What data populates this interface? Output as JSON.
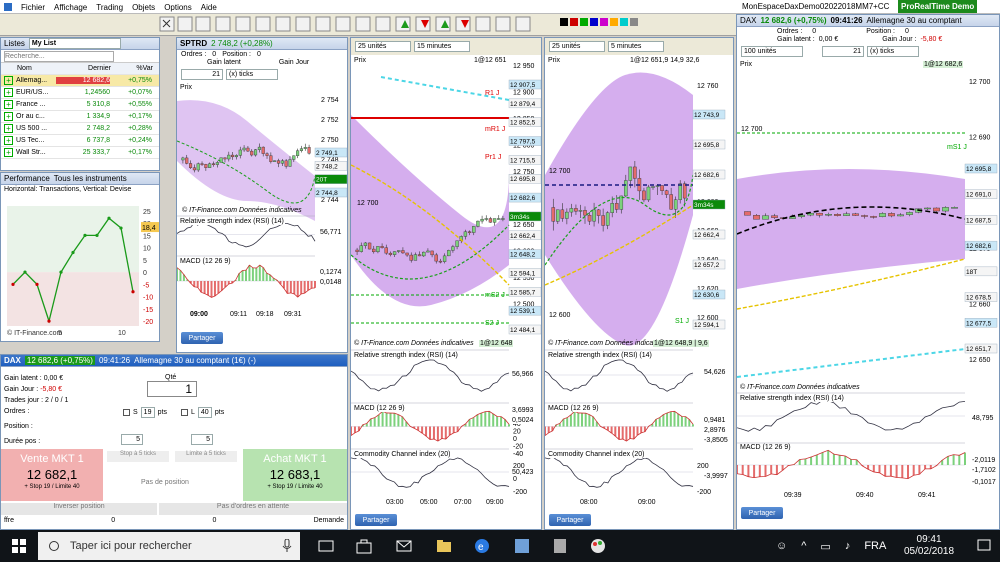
{
  "menu": {
    "items": [
      "Fichier",
      "Affichage",
      "Trading",
      "Objets",
      "Options",
      "Aide"
    ]
  },
  "window": {
    "title": "MonEspaceDaxDemo02022018MM7+CC",
    "badge": "ProRealTime Demo"
  },
  "watchlist": {
    "tabs": [
      "Listes",
      "My List"
    ],
    "search_placeholder": "Recherche...",
    "columns": [
      "Nom",
      "Dernier",
      "%Var"
    ],
    "rows": [
      {
        "name": "Allemag...",
        "last": "12 682,6",
        "chg": "+0,75%",
        "selected": true
      },
      {
        "name": "EUR/US...",
        "last": "1,24560",
        "chg": "+0,07%"
      },
      {
        "name": "France ...",
        "last": "5 310,8",
        "chg": "+0,55%"
      },
      {
        "name": "Or au c...",
        "last": "1 334,9",
        "chg": "+0,17%"
      },
      {
        "name": "US 500 ...",
        "last": "2 748,2",
        "chg": "+0,28%"
      },
      {
        "name": "US Tec...",
        "last": "6 737,8",
        "chg": "+0,24%"
      },
      {
        "name": "Wall Str...",
        "last": "25 333,7",
        "chg": "+0,17%"
      }
    ]
  },
  "performance": {
    "tabs": [
      "Performance",
      "Tous les instruments"
    ],
    "header": "Horizontal: Transactions, Vertical: Devise",
    "y_ticks": [
      "25",
      "20",
      "15",
      "10",
      "5",
      "0",
      "-5",
      "-10",
      "-15",
      "-20"
    ],
    "x_ticks": [
      "5",
      "10"
    ],
    "value_label": "18,4",
    "footer": "© IT-Finance.com",
    "chart_data": {
      "type": "line",
      "x": [
        1,
        2,
        3,
        4,
        5,
        6,
        7,
        8,
        9,
        10,
        11
      ],
      "values": [
        -5,
        0,
        -5,
        -20,
        0,
        8,
        15,
        15,
        22,
        18,
        -8
      ]
    }
  },
  "spx": {
    "title": "SPTRD",
    "price": "2 748,2 (+0,28%)",
    "orders_label": "Ordres :",
    "orders_value": "0",
    "position_label": "Position :",
    "position_value": "0",
    "gain_latent": "Gain latent",
    "gain_jour": "Gain Jour",
    "unit_select": "21",
    "type_select": "(x) ticks",
    "prix_label": "Prix",
    "y_ticks": [
      "2 754",
      "2 752",
      "2 750",
      "2 748",
      "2 746",
      "2 744"
    ],
    "price_tags": [
      "2 749,1",
      "2 748,2",
      "20T",
      "2 744,8"
    ],
    "rsi_title": "Relative strength index (RSI) (14)",
    "rsi_value": "56,771",
    "macd_title": "MACD (12 26 9)",
    "macd_values": [
      "0,1274",
      "0,0148"
    ],
    "x_ticks": [
      "09:00",
      "09:11",
      "09:18",
      "09:31"
    ],
    "credit": "© IT-Finance.com Données indicatives",
    "share": "Partager"
  },
  "dax_order": {
    "title": "DAX",
    "price": "12 682,6 (+0,75%)",
    "time": "09:41:26",
    "desc": "Allemagne 30 au comptant (1€) (-)",
    "gain_latent_label": "Gain latent :",
    "gain_latent": "0,00 €",
    "gain_jour_label": "Gain Jour :",
    "gain_jour": "-5,80 €",
    "trades_label": "Trades jour :",
    "trades": "2 / 0 / 1",
    "orders_label": "Ordres :",
    "position_label": "Position :",
    "duree_label": "Durée pos :",
    "qty_label": "Qté",
    "qty": "1",
    "stop_label": "S",
    "stop_value": "19",
    "stop_unit": "pts",
    "limit_label": "L",
    "limit_value": "40",
    "limit_unit": "pts",
    "spin1": "5",
    "spin2": "5",
    "sell_label": "Vente MKT 1",
    "sell_price": "12 682,1",
    "sell_sub": "+ Stop 19 / Limite 40",
    "buy_label": "Achat MKT 1",
    "buy_price": "12 683,1",
    "buy_sub": "+ Stop 19 / Limite 40",
    "stop5": "Stop à 5 ticks",
    "limit5": "Limite à 5 ticks",
    "no_position": "Pas de position",
    "reverse": "Inverser position",
    "no_pending": "Pas d'ordres en attente",
    "footer_left": "ffre",
    "footer_right": "Demande",
    "footer_values": [
      "0",
      "0"
    ]
  },
  "chart1": {
    "units": "25 unités",
    "interval": "15 minutes",
    "prix_label": "Prix",
    "header_price": "1@12 651",
    "y_ticks": [
      "12 950",
      "12 900",
      "12 850",
      "12 800",
      "12 750",
      "12 700",
      "12 650",
      "12 600",
      "12 550",
      "12 500",
      "12 450"
    ],
    "price_tags": [
      "12 907,5",
      "12 879,4",
      "12 852,5",
      "12 797,5",
      "12 715,5",
      "12 695,8",
      "12 682,6",
      "3m34s",
      "12 662,4",
      "12 648,2",
      "12 594,1",
      "12 585,7",
      "12 539,1",
      "12 484,1"
    ],
    "levels": [
      "R1 J",
      "mR1 J",
      "Pr1 J",
      "12 700",
      "mS2 J",
      "S2 J"
    ],
    "rsi_title": "Relative strength index (RSI) (14)",
    "rsi_value": "56,966",
    "macd_title": "MACD (12 26 9)",
    "macd_values": [
      "3,6993",
      "0,5024"
    ],
    "macd_ticks": [
      "40",
      "20",
      "0",
      "-20",
      "-40"
    ],
    "cci_title": "Commodity Channel index (20)",
    "cci_value": "50,423",
    "cci_ticks": [
      "200",
      "0",
      "-200"
    ],
    "x_ticks": [
      "03:00",
      "05:00",
      "07:00",
      "09:00"
    ],
    "credit": "© IT-Finance.com Données indicatives",
    "bottom_price": "1@12 648",
    "share": "Partager"
  },
  "chart2": {
    "units": "25 unités",
    "interval": "5 minutes",
    "header_price": "1@12 651,9 14,9 32,6",
    "prix_label": "Prix",
    "y_ticks": [
      "12 760",
      "12 740",
      "12 720",
      "12 700",
      "12 680",
      "12 660",
      "12 640",
      "12 620",
      "12 600"
    ],
    "price_tags": [
      "12 743,9",
      "12 695,8",
      "12 682,6",
      "3m34s",
      "12 662,4",
      "12 657,2",
      "12 630,6",
      "12 594,1"
    ],
    "levels": [
      "12 700",
      "S1 J",
      "12 600"
    ],
    "rsi_title": "Relative strength index (RSI) (14)",
    "rsi_value": "54,626",
    "macd_title": "MACD (12 26 9)",
    "macd_values": [
      "0,9481",
      "2,8976",
      "-3,8505"
    ],
    "cci_title": "Commodity Channel index (20)",
    "cci_value": "-3,9997",
    "cci_ticks": [
      "200",
      "-200"
    ],
    "x_ticks": [
      "08:00",
      "09:00"
    ],
    "credit": "© IT-Finance.com Données indicatives",
    "bottom_price": "1@12 648,9 | 9,6",
    "share": "Partager"
  },
  "chart3": {
    "title": "DAX",
    "price": "12 682,6 (+0,75%)",
    "time": "09:41:26",
    "desc": "Allemagne 30 au comptant",
    "orders_label": "Ordres :",
    "orders_value": "0",
    "position_label": "Position :",
    "position_value": "0",
    "gain_latent_label": "Gain latent :",
    "gain_latent": "0,00 €",
    "gain_jour_label": "Gain Jour :",
    "gain_jour": "-5,80 €",
    "units": "100 unités",
    "unit_select": "21",
    "type_select": "(x) ticks",
    "header_price": "1@12 682,6",
    "prix_label": "Prix",
    "y_ticks": [
      "12 700",
      "12 690",
      "12 680",
      "12 670",
      "12 660",
      "12 650"
    ],
    "price_tags": [
      "12 695,8",
      "12 691,0",
      "12 687,5",
      "12 682,6",
      "18T",
      "12 678,5",
      "12 677,5",
      "12 651,7"
    ],
    "levels": [
      "12 700",
      "mS1 J"
    ],
    "rsi_title": "Relative strength index (RSI) (14)",
    "rsi_value": "48,795",
    "macd_title": "MACD (12 26 9)",
    "macd_values": [
      "-2,0119",
      "-1,7102",
      "-0,1017"
    ],
    "x_ticks": [
      "09:39",
      "09:40",
      "09:41"
    ],
    "credit": "© IT-Finance.com Données indicatives",
    "share": "Partager"
  },
  "taskbar": {
    "search_placeholder": "Taper ici pour rechercher",
    "lang": "FRA",
    "time": "09:41",
    "date": "05/02/2018"
  },
  "colors": {
    "accent_green": "#0a8a0a",
    "accent_red": "#d00000",
    "band_purple": "#b36be0",
    "window_blue": "#1f5fc0"
  }
}
